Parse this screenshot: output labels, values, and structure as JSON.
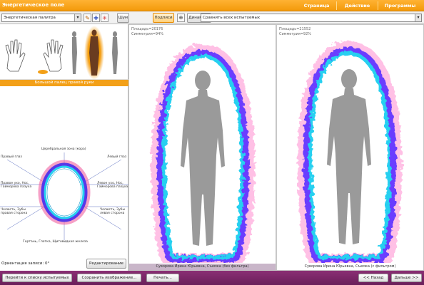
{
  "app": {
    "title": "Энергетическое поле"
  },
  "menu": [
    "Страница",
    "Действие",
    "Программы"
  ],
  "toolbar": {
    "palette_value": "Энергетическая палитра",
    "scale_label": "Шум",
    "captions_label": "Подписи",
    "dynamics_label": "Динамика",
    "compare_value": "Сравнить всех испытуемых"
  },
  "left": {
    "hand_caption": "Большой палец правой руки",
    "head_labels": {
      "top": "Церебральная зона (кора)",
      "right_eye": "Правый глаз",
      "left_eye": "Левый глаз",
      "right_ear": "Правое ухо, Нос, Гайморова пазуха",
      "left_ear": "Левое ухо, Нос, Гайморова пазуха",
      "right_jaw": "Челюсть, Зубы правая сторона",
      "left_jaw": "Челюсть, Зубы левая сторона",
      "bottom": "Гортань, Глотка, Щитовидная железа"
    },
    "orientation": "Ориентация записи: 0°",
    "edit_label": "Редактирование"
  },
  "panel_left": {
    "area": "Площадь=20176",
    "symmetry": "Симметрия=94%",
    "caption": "Суворова Ирина Юрьевна, Съемка (без фильтра)"
  },
  "panel_right": {
    "area": "Площадь=21552",
    "symmetry": "Симметрия=92%",
    "caption": "Суворова Ирина Юрьевна, Съемка (с фильтром)"
  },
  "footer": {
    "back_to_list": "Перейти к списку испытуемых",
    "save_image": "Сохранить изображение...",
    "print": "Печать...",
    "back": "<< Назад",
    "next": "Дальше >>"
  },
  "colors": {
    "accent": "#f39a0a",
    "footer": "#6a1f5a",
    "aura_outer": "#e0509a",
    "aura_mid": "#6a3cff",
    "aura_inner": "#28d0f0"
  }
}
